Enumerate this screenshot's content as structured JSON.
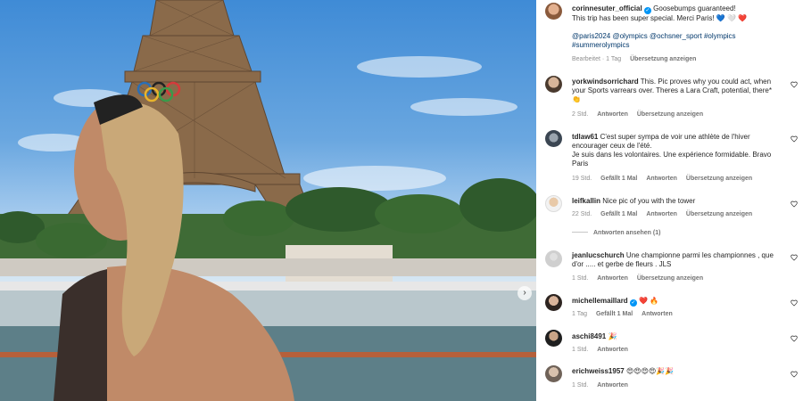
{
  "post": {
    "author": "corinnesuter_official",
    "caption_line1": "Goosebumps guaranteed!",
    "caption_line2": "This trip has been super special. Merci Paris! 💙 🤍 ❤️",
    "hashtags_line1": "@paris2024 @olympics @ochsner_sport #olympics",
    "hashtags_line2": "#summerolympics",
    "meta_edited": "Bearbeitet · 1 Tag",
    "meta_translate": "Übersetzung anzeigen"
  },
  "comments": [
    {
      "user": "yorkwindsorrichard",
      "lines": [
        "This. Pic proves why you could act, when",
        "your Sports varrears over. Theres a Lara Craft, potential, there*",
        "👏"
      ],
      "time": "2 Std.",
      "likes": "",
      "reply": "Antworten",
      "translate": "Übersetzung anzeigen"
    },
    {
      "user": "tdlaw61",
      "lines": [
        "C'est super sympa de voir une athlète de l'hiver",
        "encourager ceux de l'été.",
        "Je suis dans les volontaires. Une expérience formidable. Bravo",
        "Paris"
      ],
      "time": "19 Std.",
      "likes": "Gefällt 1 Mal",
      "reply": "Antworten",
      "translate": "Übersetzung anzeigen"
    },
    {
      "user": "leifkallin",
      "lines": [
        "Nice pic of you with the tower"
      ],
      "time": "22 Std.",
      "likes": "Gefällt 1 Mal",
      "reply": "Antworten",
      "translate": "Übersetzung anzeigen"
    },
    {
      "user": "jeanlucschurch",
      "lines": [
        "Une championne parmi les championnes , que",
        "d'or ..... et gerbe de fleurs . JLS"
      ],
      "time": "1 Std.",
      "likes": "",
      "reply": "Antworten",
      "translate": "Übersetzung anzeigen"
    },
    {
      "user": "michellemaillard",
      "lines": [
        "❤️ 🔥"
      ],
      "time": "1 Tag",
      "likes": "Gefällt 1 Mal",
      "reply": "Antworten",
      "translate": ""
    },
    {
      "user": "aschi8491",
      "lines": [
        "🎉"
      ],
      "time": "1 Std.",
      "likes": "",
      "reply": "Antworten",
      "translate": ""
    },
    {
      "user": "erichweiss1957",
      "lines": [
        "😍😍😍😍🎉🎉"
      ],
      "time": "1 Std.",
      "likes": "",
      "reply": "Antworten",
      "translate": ""
    }
  ],
  "view_replies": "Antworten ansehen (1)",
  "icons": {
    "next": "chevron-right-icon",
    "heart": "heart-outline-icon",
    "verified": "verified-badge-icon"
  },
  "colors": {
    "verified_blue": "#0095f6",
    "hashtag": "#00376b",
    "meta_gray": "#8e8e8e"
  }
}
